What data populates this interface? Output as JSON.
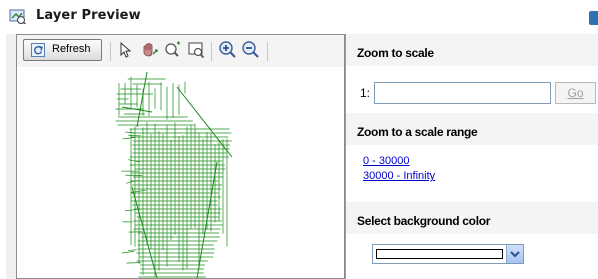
{
  "window": {
    "title": "Layer Preview",
    "title_icon": "layer-preview-icon",
    "help_icon": "help-icon"
  },
  "toolbar": {
    "refresh_label": "Refresh",
    "tools": [
      "select-pointer-icon",
      "pan-icon",
      "zoom-rectangle-icon",
      "zoom-extents-icon",
      "zoom-in-icon",
      "zoom-out-icon"
    ]
  },
  "map": {
    "stroke_color": "#1a8a1a",
    "background": "#ffffff"
  },
  "zoom_to_scale": {
    "heading": "Zoom to scale",
    "prefix": "1:",
    "value": "",
    "go_label": "Go"
  },
  "zoom_to_range": {
    "heading": "Zoom to a scale range",
    "ranges": [
      "0 - 30000",
      "30000 - Infinity"
    ]
  },
  "background_color": {
    "heading": "Select background color",
    "selected_color": "#ffffff"
  },
  "colors": {
    "link": "#0000cc",
    "header_bg": "#f4f4f4"
  }
}
